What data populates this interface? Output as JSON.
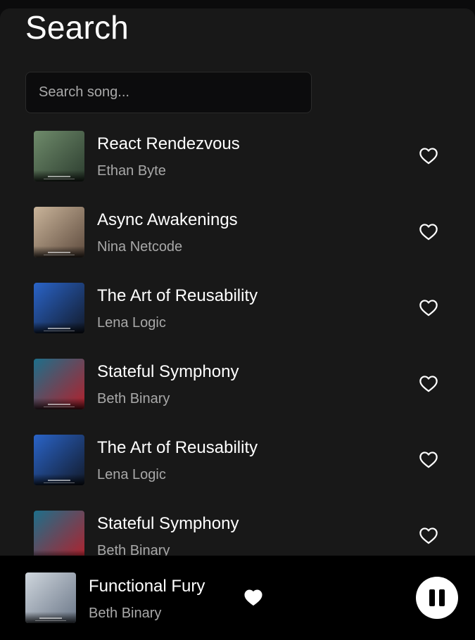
{
  "page": {
    "title": "Search"
  },
  "search": {
    "placeholder": "Search song..."
  },
  "songs": [
    {
      "title": "React Rendezvous",
      "artist": "Ethan Byte",
      "cover": [
        "#6f8b6b",
        "#2c3d2f"
      ]
    },
    {
      "title": "Async Awakenings",
      "artist": "Nina Netcode",
      "cover": [
        "#c9b49a",
        "#5d4a3d"
      ]
    },
    {
      "title": "The Art of Reusability",
      "artist": "Lena Logic",
      "cover": [
        "#2a64c8",
        "#121a2a"
      ]
    },
    {
      "title": "Stateful Symphony",
      "artist": "Beth Binary",
      "cover": [
        "#1d6f8a",
        "#b41f2a"
      ]
    },
    {
      "title": "The Art of Reusability",
      "artist": "Lena Logic",
      "cover": [
        "#2a64c8",
        "#121a2a"
      ]
    },
    {
      "title": "Stateful Symphony",
      "artist": "Beth Binary",
      "cover": [
        "#1d6f8a",
        "#b41f2a"
      ]
    }
  ],
  "now_playing": {
    "title": "Functional Fury",
    "artist": "Beth Binary",
    "liked": true,
    "state": "playing",
    "cover": [
      "#cfd6dd",
      "#6b7788"
    ]
  },
  "icons": {
    "favorite": "heart-outline-icon",
    "favorite_active": "heart-filled-icon",
    "pause": "pause-icon"
  }
}
